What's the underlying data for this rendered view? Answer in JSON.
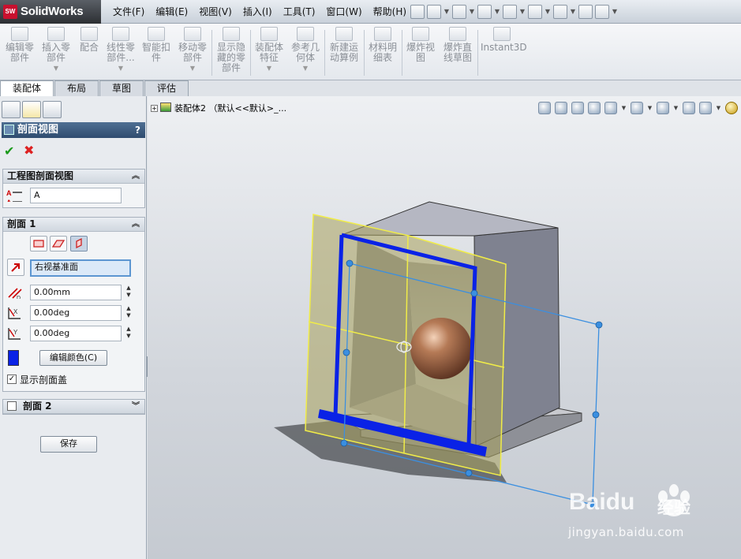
{
  "app": {
    "logo_mark": "SW",
    "name": "SolidWorks"
  },
  "menu": [
    "文件(F)",
    "编辑(E)",
    "视图(V)",
    "插入(I)",
    "工具(T)",
    "窗口(W)",
    "帮助(H)"
  ],
  "toolbar": {
    "commands": [
      {
        "label": "编辑零部件",
        "icon": "edit-component-icon"
      },
      {
        "label": "插入零部件",
        "icon": "insert-component-icon"
      },
      {
        "label": "配合",
        "icon": "mate-icon"
      },
      {
        "label": "线性零部件...",
        "icon": "linear-pattern-icon"
      },
      {
        "label": "智能扣件",
        "icon": "smart-fastener-icon"
      },
      {
        "label": "移动零部件",
        "icon": "move-component-icon"
      },
      {
        "label": "显示隐藏的零部件",
        "icon": "show-hidden-icon"
      },
      {
        "label": "装配体特征",
        "icon": "assembly-feature-icon"
      },
      {
        "label": "参考几何体",
        "icon": "reference-geometry-icon"
      },
      {
        "label": "新建运动算例",
        "icon": "motion-study-icon"
      },
      {
        "label": "材料明细表",
        "icon": "bom-icon"
      },
      {
        "label": "爆炸视图",
        "icon": "exploded-view-icon"
      },
      {
        "label": "爆炸直线草图",
        "icon": "explode-line-sketch-icon"
      },
      {
        "label": "Instant3D",
        "icon": "instant3d-icon"
      }
    ],
    "tabs": [
      "装配体",
      "布局",
      "草图",
      "评估"
    ]
  },
  "property_manager": {
    "title": "剖面视图",
    "help": "?",
    "drawing_section": {
      "header": "工程图剖面视图",
      "name_value": "A"
    },
    "section1": {
      "header": "剖面 1",
      "reference_plane": "右视基准面",
      "offset_distance": "0.00mm",
      "rotate_x": "0.00deg",
      "rotate_y": "0.00deg",
      "edit_color_label": "编辑颜色(C)",
      "section_color": "#0a22e6",
      "show_cap_label": "显示剖面盖",
      "show_cap_checked": true
    },
    "section2": {
      "header": "剖面 2",
      "enabled": false
    },
    "save_label": "保存"
  },
  "viewport": {
    "tree_label": "装配体2 （默认<<默认>_...",
    "background_top": "#eef0f3",
    "background_bottom": "#c5cad1"
  },
  "watermark": {
    "brand": "Baidu",
    "product": "经验",
    "url": "jingyan.baidu.com"
  }
}
